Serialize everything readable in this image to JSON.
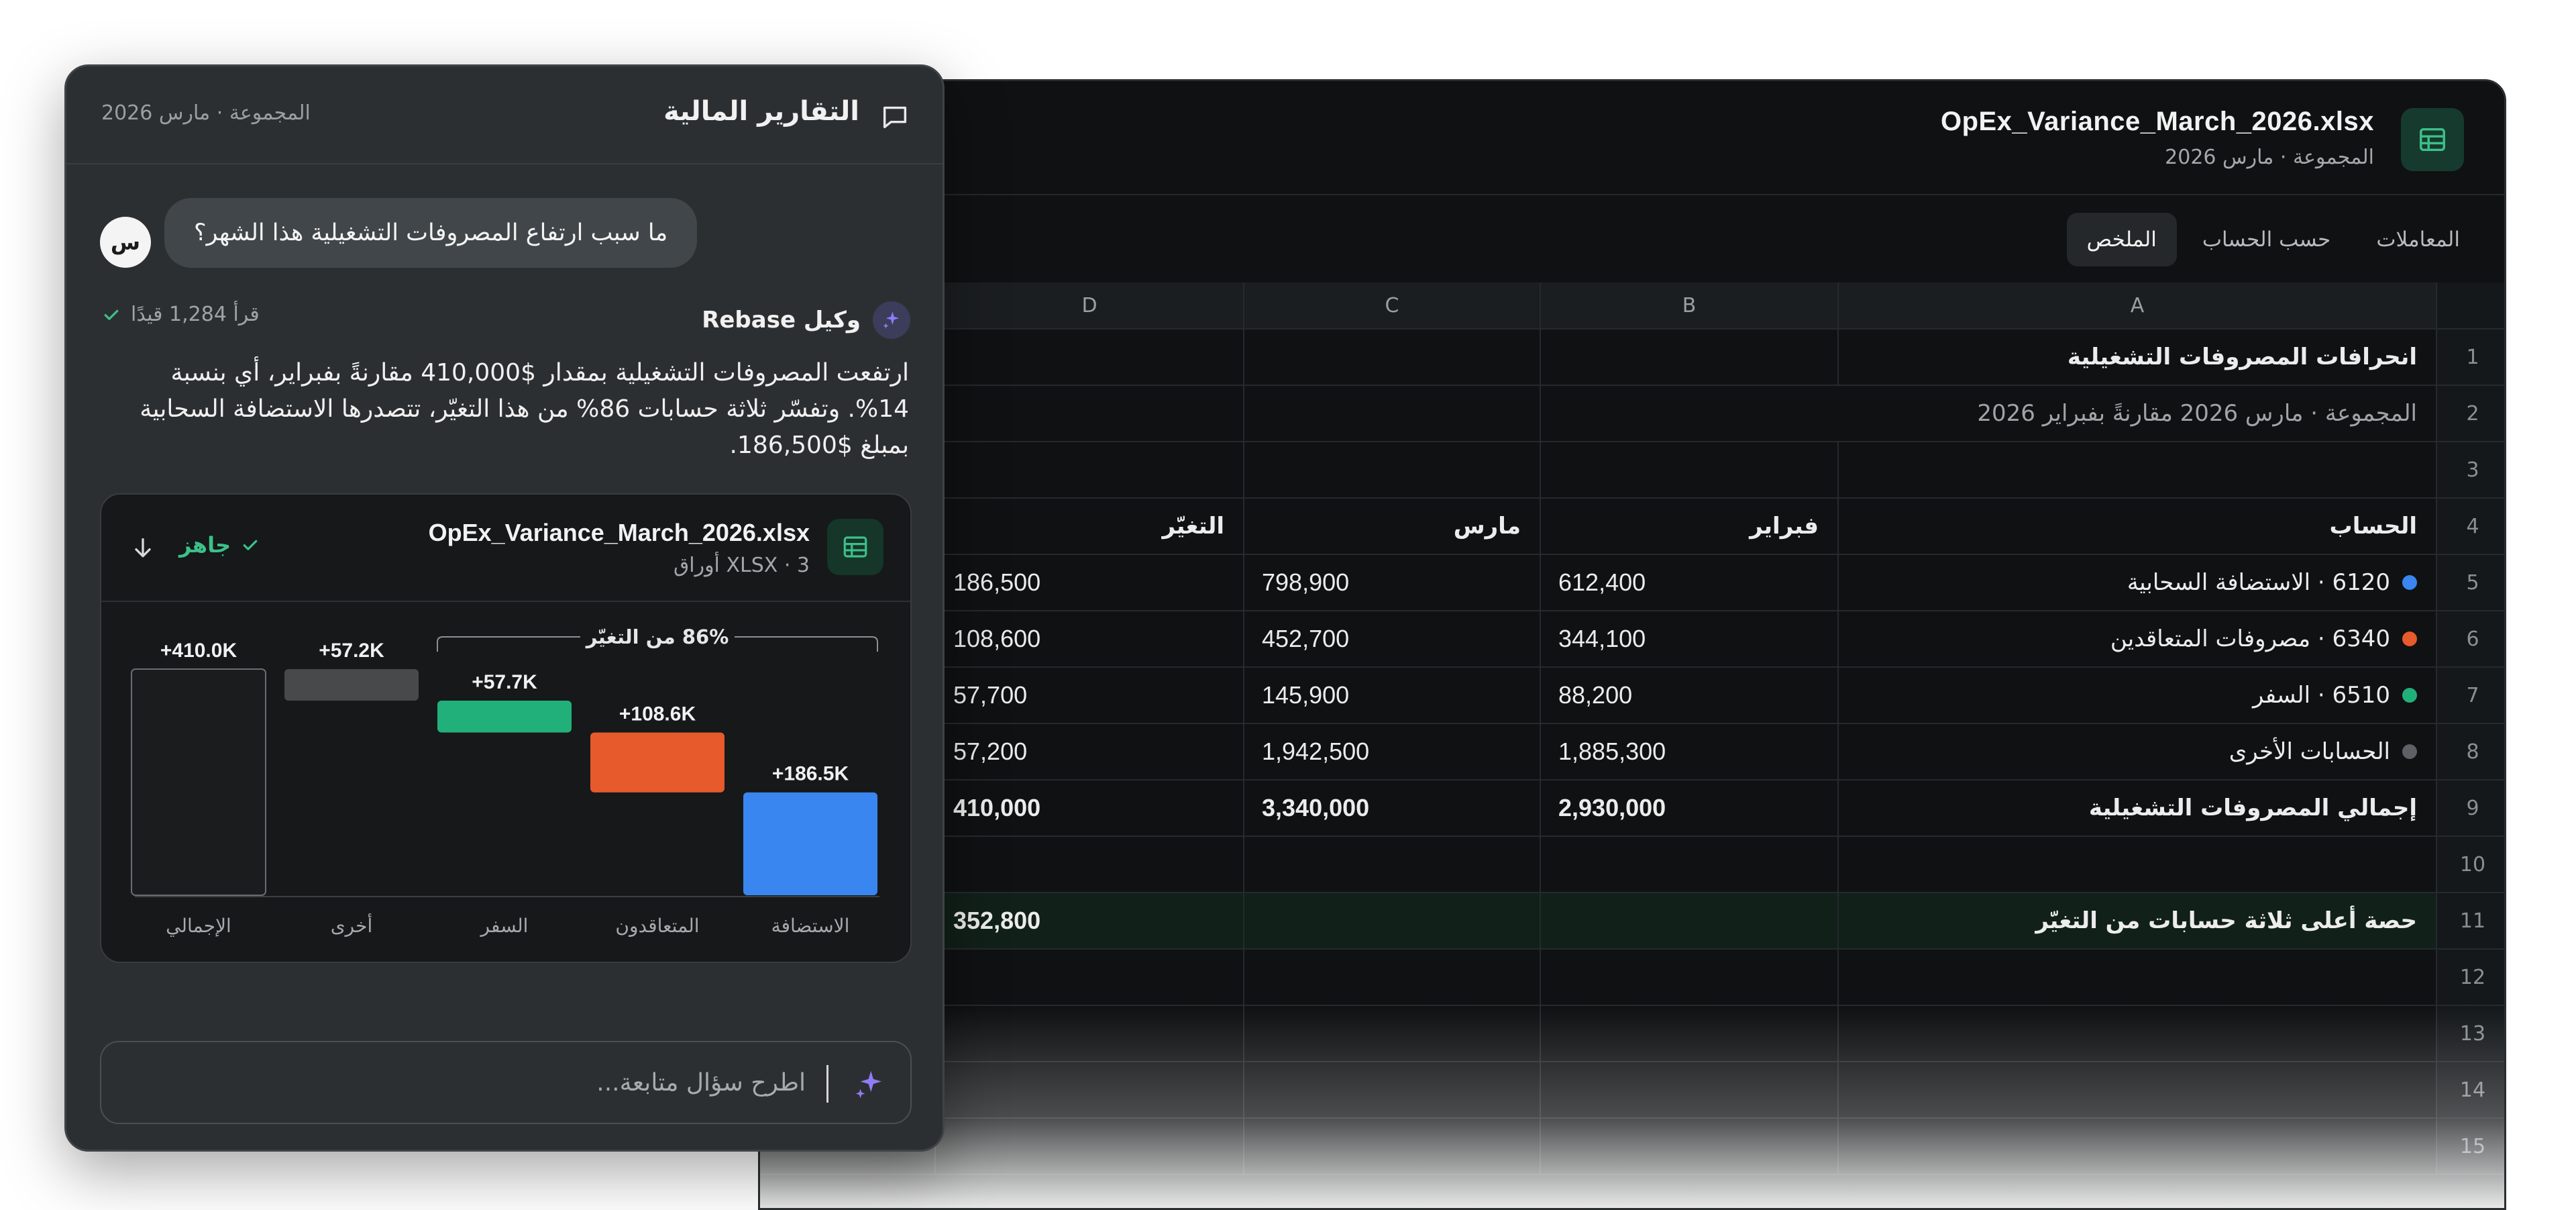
{
  "sheet": {
    "file_name": "OpEx_Variance_March_2026.xlsx",
    "subtitle": "المجموعة · مارس 2026",
    "tabs": [
      {
        "label": "الملخص",
        "active": true
      },
      {
        "label": "حسب الحساب",
        "active": false
      },
      {
        "label": "المعاملات",
        "active": false
      }
    ],
    "columns": [
      "A",
      "B",
      "C",
      "D"
    ],
    "rows": {
      "1": {
        "a": "انحرافات المصروفات التشغيلية"
      },
      "2": {
        "a": "المجموعة · مارس 2026 مقارنةً بفبراير 2026"
      },
      "4": {
        "a": "الحساب",
        "b": "فبراير",
        "c": "مارس",
        "d": "التغيّر"
      },
      "5": {
        "a": "6120 · الاستضافة السحابية",
        "b": "612,400",
        "c": "798,900",
        "d": "186,500",
        "dot": "#3a86f0"
      },
      "6": {
        "a": "6340 · مصروفات المتعاقدين",
        "b": "344,100",
        "c": "452,700",
        "d": "108,600",
        "dot": "#e65a2c"
      },
      "7": {
        "a": "6510 · السفر",
        "b": "88,200",
        "c": "145,900",
        "d": "57,700",
        "dot": "#22b07a"
      },
      "8": {
        "a": "الحسابات الأخرى",
        "b": "1,885,300",
        "c": "1,942,500",
        "d": "57,200",
        "dot": "#5d6064"
      },
      "9": {
        "a": "إجمالي المصروفات التشغيلية",
        "b": "2,930,000",
        "c": "3,340,000",
        "d": "410,000"
      },
      "11": {
        "a": "حصة أعلى ثلاثة حسابات من التغيّر",
        "d": "352,800"
      }
    },
    "row_numbers": [
      "1",
      "2",
      "3",
      "4",
      "5",
      "6",
      "7",
      "8",
      "9",
      "10",
      "11",
      "12",
      "13",
      "14",
      "15"
    ]
  },
  "chat": {
    "title": "التقارير المالية",
    "meta": "المجموعة · مارس 2026",
    "user_initial": "س",
    "user_message": "ما سبب ارتفاع المصروفات التشغيلية هذا الشهر؟",
    "agent_name": "وكيل Rebase",
    "read_count": "قرأ 1,284 قيدًا",
    "agent_message": "ارتفعت المصروفات التشغيلية بمقدار $410,000 مقارنةً بفبراير، أي بنسبة 14%. وتفسّر ثلاثة حسابات 86% من هذا التغيّر، تتصدرها الاستضافة السحابية بمبلغ $186,500.",
    "file_card": {
      "name": "OpEx_Variance_March_2026.xlsx",
      "meta": "XLSX · 3 أوراق",
      "status": "جاهز"
    },
    "followup_placeholder": "اطرح سؤال متابعة..."
  },
  "colors": {
    "hosting": "#3a86f0",
    "contractors": "#e65a2c",
    "travel": "#22b07a",
    "other": "#48494b",
    "accent_green": "#3cc08a",
    "agent_purple": "#8f7cf7"
  },
  "chart_data": {
    "type": "bar",
    "subtype": "waterfall",
    "categories": [
      "الاستضافة",
      "المتعاقدون",
      "السفر",
      "أخرى",
      "الإجمالي"
    ],
    "values": [
      186.5,
      108.6,
      57.7,
      57.2,
      410.0
    ],
    "value_labels": [
      "+186.5K",
      "+108.6K",
      "+57.7K",
      "+57.2K",
      "+410.0K"
    ],
    "unit": "K",
    "annotation": "86% من التغيّر",
    "ylim": [
      0,
      410.0
    ]
  }
}
